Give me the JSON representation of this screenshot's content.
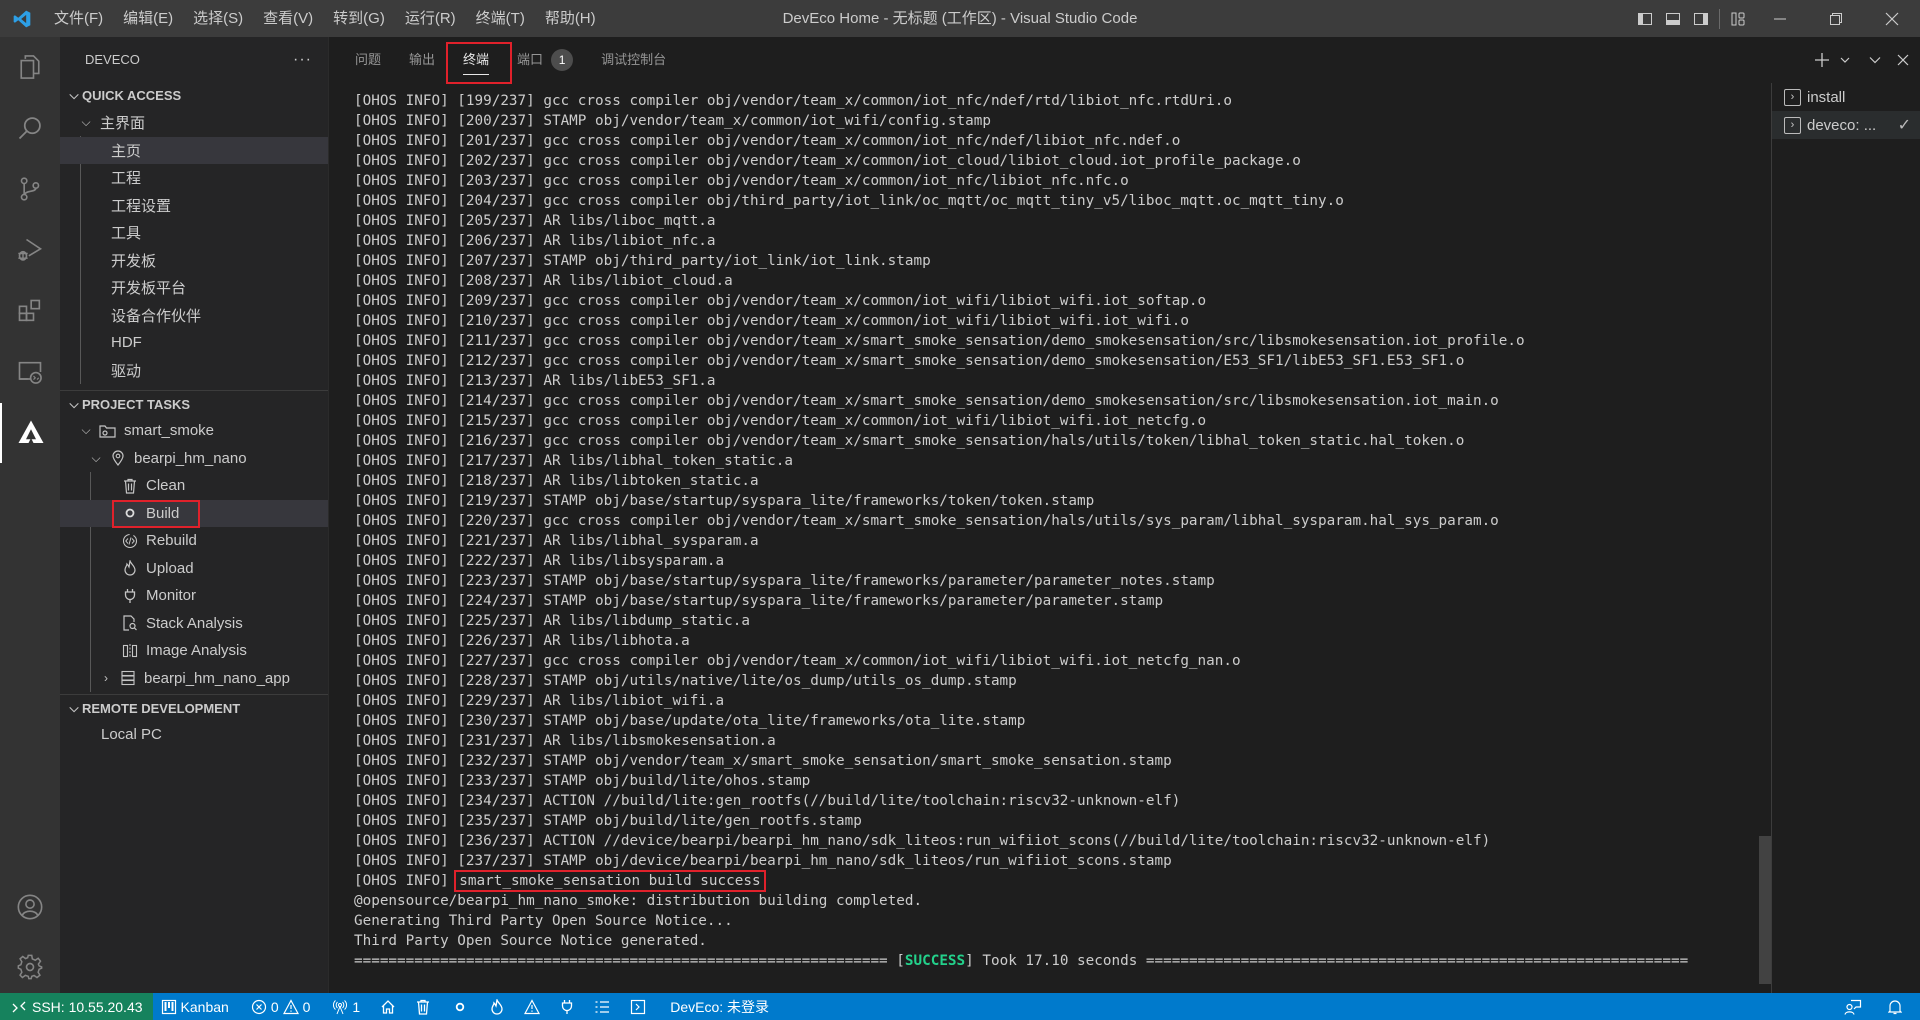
{
  "window": {
    "title": "DevEco Home - 无标题 (工作区) - Visual Studio Code",
    "menu": [
      "文件(F)",
      "编辑(E)",
      "选择(S)",
      "查看(V)",
      "转到(G)",
      "运行(R)",
      "终端(T)",
      "帮助(H)"
    ]
  },
  "activity_bar": {
    "items": [
      "explorer",
      "search",
      "source-control",
      "run-debug",
      "extensions",
      "remote-explorer",
      "deveco"
    ],
    "bottom": [
      "accounts",
      "manage"
    ]
  },
  "sidebar": {
    "title": "DEVECO",
    "more": "···",
    "quick_access": {
      "header": "QUICK ACCESS",
      "group": "主界面",
      "items": [
        "主页",
        "工程",
        "工程设置",
        "工具",
        "开发板",
        "开发板平台",
        "设备合作伙伴",
        "HDF",
        "驱动"
      ],
      "selected": "主页"
    },
    "project_tasks": {
      "header": "PROJECT TASKS",
      "project": "smart_smoke",
      "board": "bearpi_hm_nano",
      "tasks": [
        {
          "label": "Clean",
          "icon": "trash-icon"
        },
        {
          "label": "Build",
          "icon": "circle-icon"
        },
        {
          "label": "Rebuild",
          "icon": "code-cycle-icon"
        },
        {
          "label": "Upload",
          "icon": "flame-icon"
        },
        {
          "label": "Monitor",
          "icon": "plug-icon"
        },
        {
          "label": "Stack Analysis",
          "icon": "file-search-icon"
        },
        {
          "label": "Image Analysis",
          "icon": "split-icon"
        }
      ],
      "app": "bearpi_hm_nano_app",
      "selected": "Build"
    },
    "remote_development": {
      "header": "REMOTE DEVELOPMENT",
      "items": [
        "Local PC"
      ]
    }
  },
  "panel": {
    "tabs": [
      {
        "label": "问题"
      },
      {
        "label": "输出"
      },
      {
        "label": "终端",
        "active": true
      },
      {
        "label": "端口",
        "badge": "1"
      },
      {
        "label": "调试控制台"
      }
    ],
    "terminal_lines": [
      "[OHOS INFO] [199/237] gcc cross compiler obj/vendor/team_x/common/iot_nfc/ndef/rtd/libiot_nfc.rtdUri.o",
      "[OHOS INFO] [200/237] STAMP obj/vendor/team_x/common/iot_wifi/config.stamp",
      "[OHOS INFO] [201/237] gcc cross compiler obj/vendor/team_x/common/iot_nfc/ndef/libiot_nfc.ndef.o",
      "[OHOS INFO] [202/237] gcc cross compiler obj/vendor/team_x/common/iot_cloud/libiot_cloud.iot_profile_package.o",
      "[OHOS INFO] [203/237] gcc cross compiler obj/vendor/team_x/common/iot_nfc/libiot_nfc.nfc.o",
      "[OHOS INFO] [204/237] gcc cross compiler obj/third_party/iot_link/oc_mqtt/oc_mqtt_tiny_v5/liboc_mqtt.oc_mqtt_tiny.o",
      "[OHOS INFO] [205/237] AR libs/liboc_mqtt.a",
      "[OHOS INFO] [206/237] AR libs/libiot_nfc.a",
      "[OHOS INFO] [207/237] STAMP obj/third_party/iot_link/iot_link.stamp",
      "[OHOS INFO] [208/237] AR libs/libiot_cloud.a",
      "[OHOS INFO] [209/237] gcc cross compiler obj/vendor/team_x/common/iot_wifi/libiot_wifi.iot_softap.o",
      "[OHOS INFO] [210/237] gcc cross compiler obj/vendor/team_x/common/iot_wifi/libiot_wifi.iot_wifi.o",
      "[OHOS INFO] [211/237] gcc cross compiler obj/vendor/team_x/smart_smoke_sensation/demo_smokesensation/src/libsmokesensation.iot_profile.o",
      "[OHOS INFO] [212/237] gcc cross compiler obj/vendor/team_x/smart_smoke_sensation/demo_smokesensation/E53_SF1/libE53_SF1.E53_SF1.o",
      "[OHOS INFO] [213/237] AR libs/libE53_SF1.a",
      "[OHOS INFO] [214/237] gcc cross compiler obj/vendor/team_x/smart_smoke_sensation/demo_smokesensation/src/libsmokesensation.iot_main.o",
      "[OHOS INFO] [215/237] gcc cross compiler obj/vendor/team_x/common/iot_wifi/libiot_wifi.iot_netcfg.o",
      "[OHOS INFO] [216/237] gcc cross compiler obj/vendor/team_x/smart_smoke_sensation/hals/utils/token/libhal_token_static.hal_token.o",
      "[OHOS INFO] [217/237] AR libs/libhal_token_static.a",
      "[OHOS INFO] [218/237] AR libs/libtoken_static.a",
      "[OHOS INFO] [219/237] STAMP obj/base/startup/syspara_lite/frameworks/token/token.stamp",
      "[OHOS INFO] [220/237] gcc cross compiler obj/vendor/team_x/smart_smoke_sensation/hals/utils/sys_param/libhal_sysparam.hal_sys_param.o",
      "[OHOS INFO] [221/237] AR libs/libhal_sysparam.a",
      "[OHOS INFO] [222/237] AR libs/libsysparam.a",
      "[OHOS INFO] [223/237] STAMP obj/base/startup/syspara_lite/frameworks/parameter/parameter_notes.stamp",
      "[OHOS INFO] [224/237] STAMP obj/base/startup/syspara_lite/frameworks/parameter/parameter.stamp",
      "[OHOS INFO] [225/237] AR libs/libdump_static.a",
      "[OHOS INFO] [226/237] AR libs/libhota.a",
      "[OHOS INFO] [227/237] gcc cross compiler obj/vendor/team_x/common/iot_wifi/libiot_wifi.iot_netcfg_nan.o",
      "[OHOS INFO] [228/237] STAMP obj/utils/native/lite/os_dump/utils_os_dump.stamp",
      "[OHOS INFO] [229/237] AR libs/libiot_wifi.a",
      "[OHOS INFO] [230/237] STAMP obj/base/update/ota_lite/frameworks/ota_lite.stamp",
      "[OHOS INFO] [231/237] AR libs/libsmokesensation.a",
      "[OHOS INFO] [232/237] STAMP obj/vendor/team_x/smart_smoke_sensation/smart_smoke_sensation.stamp",
      "[OHOS INFO] [233/237] STAMP obj/build/lite/ohos.stamp",
      "[OHOS INFO] [234/237] ACTION //build/lite:gen_rootfs(//build/lite/toolchain:riscv32-unknown-elf)",
      "[OHOS INFO] [235/237] STAMP obj/build/lite/gen_rootfs.stamp",
      "[OHOS INFO] [236/237] ACTION //device/bearpi/bearpi_hm_nano/sdk_liteos:run_wifiiot_scons(//build/lite/toolchain:riscv32-unknown-elf)",
      "[OHOS INFO] [237/237] STAMP obj/device/bearpi/bearpi_hm_nano/sdk_liteos/run_wifiiot_scons.stamp"
    ],
    "success_line": {
      "prefix": "[OHOS INFO] ",
      "message": "smart_smoke_sensation build success"
    },
    "after_lines": [
      "@opensource/bearpi_hm_nano_smoke: distribution building completed.",
      "Generating Third Party Open Source Notice...",
      "Third Party Open Source Notice generated."
    ],
    "summary": {
      "left_rule": "============================================================== [",
      "status": "SUCCESS",
      "right_text": "] Took 17.10 seconds ==============================================================="
    },
    "terminals": [
      {
        "label": "install"
      },
      {
        "label": "deveco: ...",
        "active": true,
        "status": "✓"
      }
    ],
    "actions": {
      "new": "+",
      "split_dropdown": "⌄",
      "maximize": "⌄",
      "close": "✕"
    }
  },
  "statusbar": {
    "remote": "SSH: 10.55.20.43",
    "kanban": "Kanban",
    "errors": "0",
    "warnings": "0",
    "ports": "1",
    "deveco": "DevEco: 未登录"
  },
  "colors": {
    "accent": "#007acc",
    "remote": "#16825d",
    "success": "#23d18b",
    "highlight_box": "#e0212b"
  }
}
